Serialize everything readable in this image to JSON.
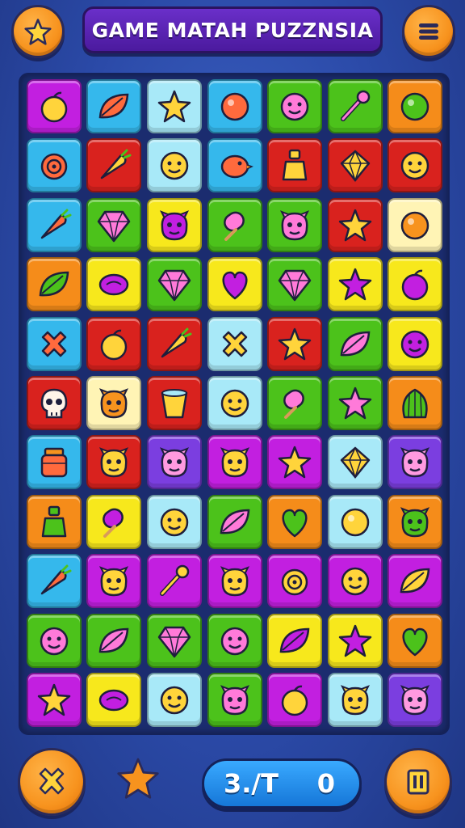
{
  "header": {
    "title": "GAME MATAH PUZZNSIA",
    "left_button_icon": "star-icon",
    "right_button_icon": "menu-icon"
  },
  "footer": {
    "left_button_icon": "close-icon",
    "star_icon": "star-icon",
    "moves_text": "3./T",
    "score_text": "0",
    "right_button_icon": "pause-icon"
  },
  "colors": {
    "magenta": "#c21fe0",
    "green": "#4cc21b",
    "cyan": "#35b8ec",
    "lightcyan": "#a8e9f8",
    "red": "#d9221e",
    "orange": "#f58c1a",
    "yellow": "#f7e81c",
    "cream": "#fff4b5",
    "purple": "#7b3ee0",
    "accent_orange": "#f7931e",
    "title_purple": "#5a24b8",
    "score_blue": "#2a90ee"
  },
  "board": {
    "rows": [
      [
        {
          "c": "magenta",
          "i": "apple"
        },
        {
          "c": "cyan",
          "i": "leaf"
        },
        {
          "c": "lightcyan",
          "i": "star"
        },
        {
          "c": "cyan",
          "i": "circle"
        },
        {
          "c": "green",
          "i": "face"
        },
        {
          "c": "green",
          "i": "wand"
        },
        {
          "c": "orange",
          "i": "circle"
        }
      ],
      [
        {
          "c": "cyan",
          "i": "swirl"
        },
        {
          "c": "red",
          "i": "carrot"
        },
        {
          "c": "lightcyan",
          "i": "face"
        },
        {
          "c": "cyan",
          "i": "bird"
        },
        {
          "c": "red",
          "i": "bottle"
        },
        {
          "c": "red",
          "i": "diamond"
        },
        {
          "c": "red",
          "i": "face"
        }
      ],
      [
        {
          "c": "cyan",
          "i": "carrot"
        },
        {
          "c": "green",
          "i": "gem"
        },
        {
          "c": "yellow",
          "i": "monster"
        },
        {
          "c": "green",
          "i": "popsicle"
        },
        {
          "c": "green",
          "i": "monster"
        },
        {
          "c": "red",
          "i": "star"
        },
        {
          "c": "cream",
          "i": "circle"
        }
      ],
      [
        {
          "c": "orange",
          "i": "leaf"
        },
        {
          "c": "yellow",
          "i": "candy"
        },
        {
          "c": "green",
          "i": "gem"
        },
        {
          "c": "yellow",
          "i": "heart"
        },
        {
          "c": "green",
          "i": "gem"
        },
        {
          "c": "yellow",
          "i": "star"
        },
        {
          "c": "yellow",
          "i": "apple"
        }
      ],
      [
        {
          "c": "cyan",
          "i": "x"
        },
        {
          "c": "red",
          "i": "apple"
        },
        {
          "c": "red",
          "i": "carrot"
        },
        {
          "c": "lightcyan",
          "i": "x"
        },
        {
          "c": "red",
          "i": "star"
        },
        {
          "c": "green",
          "i": "leaf"
        },
        {
          "c": "yellow",
          "i": "face"
        }
      ],
      [
        {
          "c": "red",
          "i": "skull"
        },
        {
          "c": "cream",
          "i": "monster"
        },
        {
          "c": "red",
          "i": "cup"
        },
        {
          "c": "lightcyan",
          "i": "face"
        },
        {
          "c": "green",
          "i": "popsicle"
        },
        {
          "c": "green",
          "i": "star"
        },
        {
          "c": "orange",
          "i": "shell"
        }
      ],
      [
        {
          "c": "cyan",
          "i": "jar"
        },
        {
          "c": "red",
          "i": "monster"
        },
        {
          "c": "purple",
          "i": "monster"
        },
        {
          "c": "magenta",
          "i": "monster"
        },
        {
          "c": "magenta",
          "i": "star"
        },
        {
          "c": "lightcyan",
          "i": "diamond"
        },
        {
          "c": "purple",
          "i": "monster"
        }
      ],
      [
        {
          "c": "orange",
          "i": "bottle"
        },
        {
          "c": "yellow",
          "i": "popsicle"
        },
        {
          "c": "lightcyan",
          "i": "face"
        },
        {
          "c": "green",
          "i": "leaf"
        },
        {
          "c": "orange",
          "i": "heart"
        },
        {
          "c": "lightcyan",
          "i": "circle"
        },
        {
          "c": "orange",
          "i": "monster"
        }
      ],
      [
        {
          "c": "cyan",
          "i": "carrot"
        },
        {
          "c": "magenta",
          "i": "monster"
        },
        {
          "c": "magenta",
          "i": "wand"
        },
        {
          "c": "magenta",
          "i": "monster"
        },
        {
          "c": "magenta",
          "i": "swirl"
        },
        {
          "c": "magenta",
          "i": "face"
        },
        {
          "c": "magenta",
          "i": "leaf"
        }
      ],
      [
        {
          "c": "green",
          "i": "face"
        },
        {
          "c": "green",
          "i": "leaf"
        },
        {
          "c": "green",
          "i": "gem"
        },
        {
          "c": "green",
          "i": "face"
        },
        {
          "c": "yellow",
          "i": "leaf"
        },
        {
          "c": "yellow",
          "i": "star"
        },
        {
          "c": "orange",
          "i": "heart"
        }
      ],
      [
        {
          "c": "magenta",
          "i": "star"
        },
        {
          "c": "yellow",
          "i": "candy"
        },
        {
          "c": "lightcyan",
          "i": "face"
        },
        {
          "c": "green",
          "i": "monster"
        },
        {
          "c": "magenta",
          "i": "apple"
        },
        {
          "c": "lightcyan",
          "i": "monster"
        },
        {
          "c": "purple",
          "i": "monster"
        }
      ]
    ]
  }
}
